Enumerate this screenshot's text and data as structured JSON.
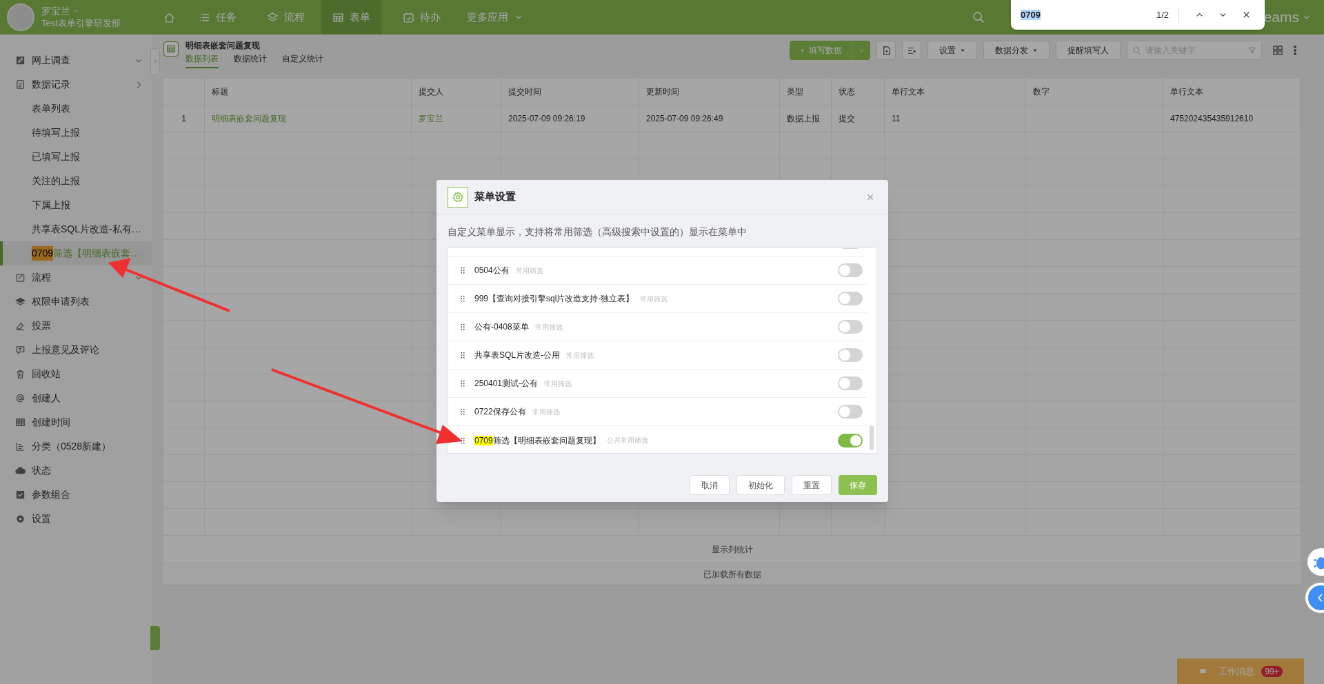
{
  "user": {
    "name": "罗宝兰",
    "department": "Test表单引擎研发部"
  },
  "nav": [
    {
      "kind": "home",
      "selected": false
    },
    {
      "kind": "tasks",
      "label": "任务",
      "selected": false
    },
    {
      "kind": "flow",
      "label": "流程",
      "selected": false
    },
    {
      "kind": "form",
      "label": "表单",
      "selected": true
    },
    {
      "kind": "todo",
      "label": "待办",
      "selected": false
    },
    {
      "kind": "more",
      "label": "更多应用",
      "selected": false
    }
  ],
  "app_switcher": "eams",
  "find_bar": {
    "query": "0709",
    "count": "1/2"
  },
  "sidebar": {
    "items": [
      {
        "kind": "edit",
        "label": "网上调查",
        "expanded": true
      },
      {
        "kind": "record",
        "label": "数据记录",
        "expanded": false,
        "children": [
          {
            "label": "表单列表",
            "selected": false
          },
          {
            "label": "待填写上报",
            "selected": false
          },
          {
            "label": "已填写上报",
            "selected": false
          },
          {
            "label": "关注的上报",
            "selected": false
          },
          {
            "label": "下属上报",
            "selected": false
          },
          {
            "label": "共享表SQL片改造-私有…",
            "selected": false
          },
          {
            "match": "0709",
            "match_current": true,
            "label": "筛选【明细表嵌套…",
            "selected": true
          }
        ]
      },
      {
        "kind": "flow",
        "label": "流程",
        "expanded": true
      },
      {
        "kind": "layers",
        "label": "权限申请列表"
      },
      {
        "kind": "vote",
        "label": "投票"
      },
      {
        "kind": "comment",
        "label": "上报意见及评论"
      },
      {
        "kind": "trash",
        "label": "回收站"
      },
      {
        "kind": "at",
        "label": "创建人"
      },
      {
        "kind": "table",
        "label": "创建时间"
      },
      {
        "kind": "bars",
        "label": "分类（0528新建）"
      },
      {
        "kind": "cloud",
        "label": "状态"
      },
      {
        "kind": "checkbox",
        "label": "参数组合"
      },
      {
        "kind": "gear",
        "label": "设置"
      }
    ]
  },
  "page": {
    "title": "明细表嵌套问题复现",
    "tabs": [
      {
        "label": "数据列表",
        "selected": true
      },
      {
        "label": "数据统计",
        "selected": false
      },
      {
        "label": "自定义统计",
        "selected": false
      }
    ],
    "toolbar": {
      "primary": "填写数据",
      "menus": [
        "设置",
        "数据分发"
      ],
      "remind": "提醒填写人",
      "search_placeholder": "请输入关键字"
    }
  },
  "table": {
    "columns": [
      {
        "label": "标题",
        "kind": "link"
      },
      {
        "label": "提交人",
        "kind": "link"
      },
      {
        "label": "提交时间",
        "kind": "text"
      },
      {
        "label": "更新时间",
        "kind": "text"
      },
      {
        "label": "类型",
        "kind": "text"
      },
      {
        "label": "状态",
        "kind": "text"
      },
      {
        "label": "单行文本",
        "kind": "text"
      },
      {
        "label": "数字"
      },
      {
        "label": "单行文本",
        "kind": "text"
      }
    ],
    "rows": [
      {
        "number": "1",
        "cells": [
          "明细表嵌套问题复现",
          "罗宝兰",
          "2025-07-09 09:26:19",
          "2025-07-09 09:26:49",
          "数据上报",
          "提交",
          "11",
          null,
          "475202435435912610"
        ]
      }
    ],
    "column_stats": "显示列统计",
    "footer": "已加载所有数据"
  },
  "modal": {
    "title": "菜单设置",
    "description": "自定义菜单显示，支持将常用筛选（高级搜索中设置的）显示在菜单中",
    "items": [
      {
        "on": false
      },
      {
        "label": "0504公有",
        "tag": "常用筛选",
        "on": false
      },
      {
        "label": "999【查询对接引擎sql片改造支持-独立表】",
        "tag": "常用筛选",
        "on": false
      },
      {
        "label": "公有-0408菜单",
        "tag": "常用筛选",
        "on": false
      },
      {
        "label": "共享表SQL片改造-公用",
        "tag": "常用筛选",
        "on": false
      },
      {
        "label": "250401测试-公有",
        "tag": "常用筛选",
        "on": false
      },
      {
        "label": "0722保存公有",
        "tag": "常用筛选",
        "on": false
      },
      {
        "match": "0709",
        "label": "筛选【明细表嵌套问题复现】",
        "tag": "公共常用筛选",
        "on": true
      }
    ],
    "buttons": [
      {
        "label": "取消",
        "kind": "default"
      },
      {
        "label": "初始化",
        "kind": "default"
      },
      {
        "label": "重置",
        "kind": "default"
      },
      {
        "label": "保存",
        "kind": "primary"
      }
    ]
  },
  "work_messages": {
    "label": "工作消息",
    "badge": "99+"
  }
}
